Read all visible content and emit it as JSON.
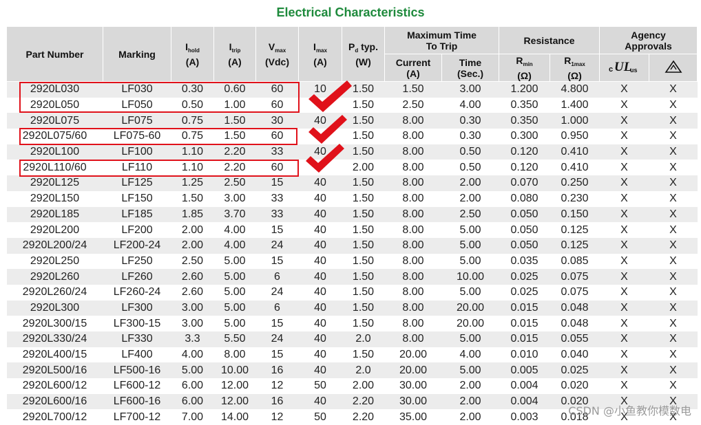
{
  "title": "Electrical Characteristics",
  "headers": {
    "part_number": "Part Number",
    "marking": "Marking",
    "ihold_main": "I",
    "ihold_sub": "hold",
    "ihold_unit": "(A)",
    "itrip_main": "I",
    "itrip_sub": "trip",
    "itrip_unit": "(A)",
    "vmax_main": "V",
    "vmax_sub": "max",
    "vmax_unit": "(Vdc)",
    "imax_main": "I",
    "imax_sub": "max",
    "imax_unit": "(A)",
    "pd_main": "P",
    "pd_sub": "d",
    "pd_typ": "typ.",
    "pd_unit": "(W)",
    "max_time_line1": "Maximum Time",
    "max_time_line2": "To Trip",
    "current": "Current",
    "current_unit": "(A)",
    "time": "Time",
    "time_unit": "(Sec.)",
    "resistance": "Resistance",
    "rmin_main": "R",
    "rmin_sub": "min",
    "rmin_unit": "(Ω)",
    "r1max_main": "R",
    "r1max_sub": "1max",
    "r1max_unit": "(Ω)",
    "agency_line1": "Agency",
    "agency_line2": "Approvals",
    "ul_mark": "cULus",
    "tuv_mark": "triangle-mark"
  },
  "rows": [
    [
      "2920L030",
      "LF030",
      "0.30",
      "0.60",
      "60",
      "10",
      "1.50",
      "1.50",
      "3.00",
      "1.200",
      "4.800",
      "X",
      "X"
    ],
    [
      "2920L050",
      "LF050",
      "0.50",
      "1.00",
      "60",
      "",
      "1.50",
      "2.50",
      "4.00",
      "0.350",
      "1.400",
      "X",
      "X"
    ],
    [
      "2920L075",
      "LF075",
      "0.75",
      "1.50",
      "30",
      "40",
      "1.50",
      "8.00",
      "0.30",
      "0.350",
      "1.000",
      "X",
      "X"
    ],
    [
      "2920L075/60",
      "LF075-60",
      "0.75",
      "1.50",
      "60",
      "",
      "1.50",
      "8.00",
      "0.30",
      "0.300",
      "0.950",
      "X",
      "X"
    ],
    [
      "2920L100",
      "LF100",
      "1.10",
      "2.20",
      "33",
      "40",
      "1.50",
      "8.00",
      "0.50",
      "0.120",
      "0.410",
      "X",
      "X"
    ],
    [
      "2920L110/60",
      "LF110",
      "1.10",
      "2.20",
      "60",
      "",
      "2.00",
      "8.00",
      "0.50",
      "0.120",
      "0.410",
      "X",
      "X"
    ],
    [
      "2920L125",
      "LF125",
      "1.25",
      "2.50",
      "15",
      "40",
      "1.50",
      "8.00",
      "2.00",
      "0.070",
      "0.250",
      "X",
      "X"
    ],
    [
      "2920L150",
      "LF150",
      "1.50",
      "3.00",
      "33",
      "40",
      "1.50",
      "8.00",
      "2.00",
      "0.080",
      "0.230",
      "X",
      "X"
    ],
    [
      "2920L185",
      "LF185",
      "1.85",
      "3.70",
      "33",
      "40",
      "1.50",
      "8.00",
      "2.50",
      "0.050",
      "0.150",
      "X",
      "X"
    ],
    [
      "2920L200",
      "LF200",
      "2.00",
      "4.00",
      "15",
      "40",
      "1.50",
      "8.00",
      "5.00",
      "0.050",
      "0.125",
      "X",
      "X"
    ],
    [
      "2920L200/24",
      "LF200-24",
      "2.00",
      "4.00",
      "24",
      "40",
      "1.50",
      "8.00",
      "5.00",
      "0.050",
      "0.125",
      "X",
      "X"
    ],
    [
      "2920L250",
      "LF250",
      "2.50",
      "5.00",
      "15",
      "40",
      "1.50",
      "8.00",
      "5.00",
      "0.035",
      "0.085",
      "X",
      "X"
    ],
    [
      "2920L260",
      "LF260",
      "2.60",
      "5.00",
      "6",
      "40",
      "1.50",
      "8.00",
      "10.00",
      "0.025",
      "0.075",
      "X",
      "X"
    ],
    [
      "2920L260/24",
      "LF260-24",
      "2.60",
      "5.00",
      "24",
      "40",
      "1.50",
      "8.00",
      "5.00",
      "0.025",
      "0.075",
      "X",
      "X"
    ],
    [
      "2920L300",
      "LF300",
      "3.00",
      "5.00",
      "6",
      "40",
      "1.50",
      "8.00",
      "20.00",
      "0.015",
      "0.048",
      "X",
      "X"
    ],
    [
      "2920L300/15",
      "LF300-15",
      "3.00",
      "5.00",
      "15",
      "40",
      "1.50",
      "8.00",
      "20.00",
      "0.015",
      "0.048",
      "X",
      "X"
    ],
    [
      "2920L330/24",
      "LF330",
      "3.3",
      "5.50",
      "24",
      "40",
      "2.0",
      "8.00",
      "5.00",
      "0.015",
      "0.055",
      "X",
      "X"
    ],
    [
      "2920L400/15",
      "LF400",
      "4.00",
      "8.00",
      "15",
      "40",
      "1.50",
      "20.00",
      "4.00",
      "0.010",
      "0.040",
      "X",
      "X"
    ],
    [
      "2920L500/16",
      "LF500-16",
      "5.00",
      "10.00",
      "16",
      "40",
      "2.0",
      "20.00",
      "5.00",
      "0.005",
      "0.025",
      "X",
      "X"
    ],
    [
      "2920L600/12",
      "LF600-12",
      "6.00",
      "12.00",
      "12",
      "50",
      "2.00",
      "30.00",
      "2.00",
      "0.004",
      "0.020",
      "X",
      "X"
    ],
    [
      "2920L600/16",
      "LF600-16",
      "6.00",
      "12.00",
      "16",
      "40",
      "2.20",
      "30.00",
      "2.00",
      "0.004",
      "0.020",
      "X",
      "X"
    ],
    [
      "2920L700/12",
      "LF700-12",
      "7.00",
      "14.00",
      "12",
      "50",
      "2.20",
      "35.00",
      "2.00",
      "0.003",
      "0.018",
      "X",
      "X"
    ]
  ],
  "watermark": "CSDN @小鱼教你模数电",
  "colors": {
    "title": "#1e8a3c",
    "header_bg": "#d9d9d9",
    "stripe": "#ececec",
    "highlight": "#e0111a"
  }
}
